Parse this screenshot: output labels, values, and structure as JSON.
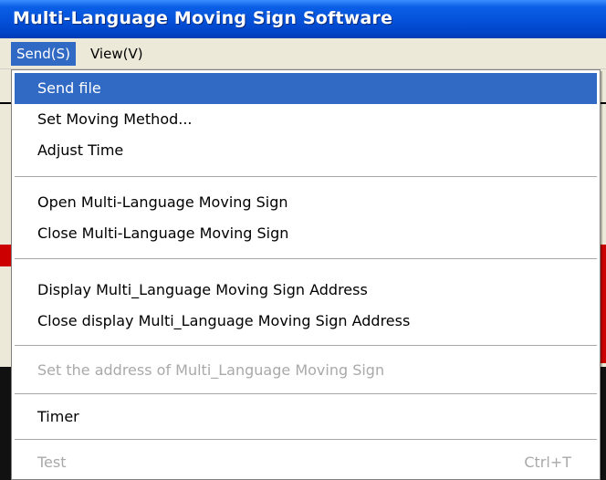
{
  "window": {
    "title": "Multi-Language Moving Sign Software"
  },
  "menubar": {
    "items": [
      {
        "label": "Send(S)",
        "active": true
      },
      {
        "label": "View(V)",
        "active": false
      }
    ]
  },
  "dropdown": {
    "items": [
      {
        "label": "Send file",
        "highlighted": true,
        "enabled": true
      },
      {
        "label": "Set Moving Method...",
        "enabled": true
      },
      {
        "label": "Adjust Time",
        "enabled": true
      },
      {
        "label": "Open Multi-Language Moving Sign",
        "enabled": true
      },
      {
        "label": "Close Multi-Language Moving Sign",
        "enabled": true
      },
      {
        "label": "Display Multi_Language Moving Sign Address",
        "enabled": true
      },
      {
        "label": "Close display Multi_Language Moving Sign Address",
        "enabled": true
      },
      {
        "label": "Set the address of Multi_Language Moving Sign",
        "enabled": false
      },
      {
        "label": "Timer",
        "enabled": true
      },
      {
        "label": "Test",
        "shortcut": "Ctrl+T",
        "enabled": false
      }
    ]
  },
  "colors": {
    "title_bar": "#0451d8",
    "selection": "#316ac5",
    "menu_background": "#ffffff",
    "disabled_text": "#a9a9a9",
    "edge_accent_red": "#cc0000"
  }
}
